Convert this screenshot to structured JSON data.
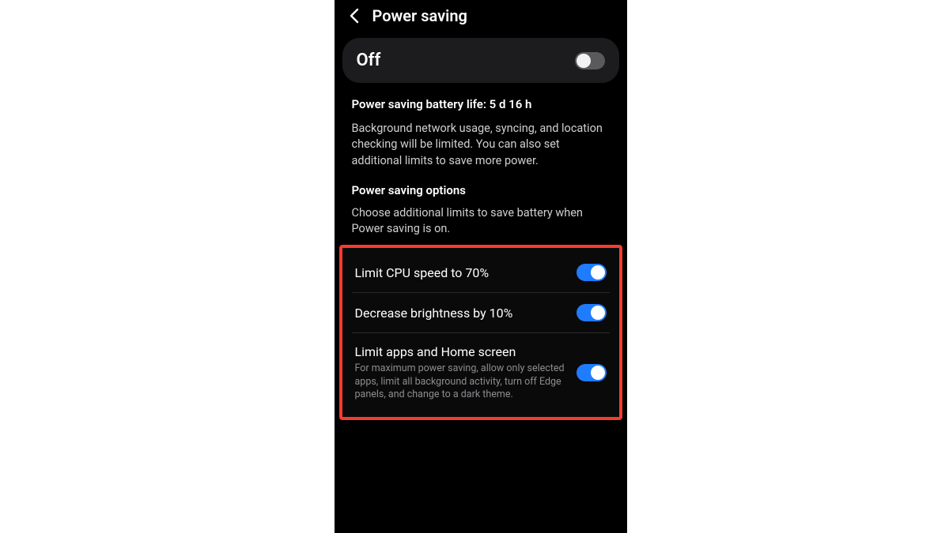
{
  "header": {
    "title": "Power saving"
  },
  "mainToggle": {
    "label": "Off",
    "state": "off"
  },
  "batteryLifeLine": "Power saving battery life: 5 d 16 h",
  "description": "Background network usage, syncing, and location checking will be limited. You can also set additional limits to save more power.",
  "optionsHeader": "Power saving options",
  "optionsDescription": "Choose additional limits to save battery when Power saving is on.",
  "options": [
    {
      "label": "Limit CPU speed to 70%",
      "sub": "",
      "state": "on"
    },
    {
      "label": "Decrease brightness by 10%",
      "sub": "",
      "state": "on"
    },
    {
      "label": "Limit apps and Home screen",
      "sub": "For maximum power saving, allow only selected apps, limit all background activity, turn off Edge panels, and change to a dark theme.",
      "state": "on"
    }
  ]
}
